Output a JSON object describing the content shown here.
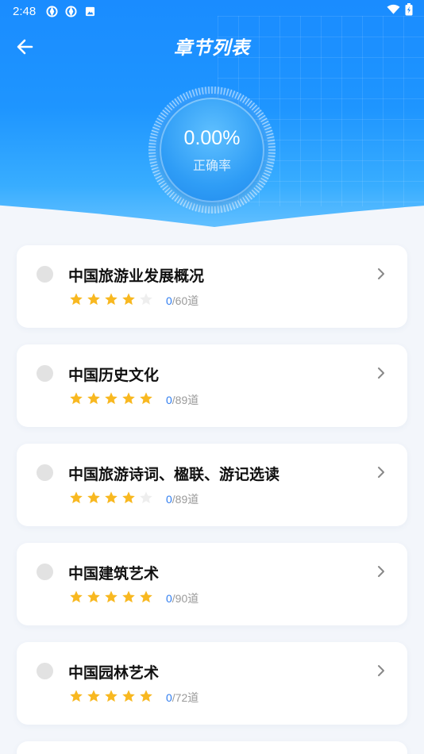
{
  "status_bar": {
    "time": "2:48",
    "icons": [
      "aperture-icon",
      "aperture-icon",
      "image-notification-icon"
    ],
    "right_icons": [
      "wifi-icon",
      "battery-icon"
    ]
  },
  "header": {
    "title": "章节列表",
    "back_icon": "arrow-left-icon"
  },
  "accuracy": {
    "value": "0.00%",
    "label": "正确率"
  },
  "colors": {
    "primary": "#1a8cff",
    "star_on": "#f8b820",
    "star_off": "#eeeeee",
    "done_count": "#2f7df0"
  },
  "chapters": [
    {
      "name": "中国旅游业发展概况",
      "stars": 4,
      "done": "0",
      "total": "/60道"
    },
    {
      "name": "中国历史文化",
      "stars": 5,
      "done": "0",
      "total": "/89道"
    },
    {
      "name": "中国旅游诗词、楹联、游记选读",
      "stars": 4,
      "done": "0",
      "total": "/89道"
    },
    {
      "name": "中国建筑艺术",
      "stars": 5,
      "done": "0",
      "total": "/90道"
    },
    {
      "name": "中国园林艺术",
      "stars": 5,
      "done": "0",
      "total": "/72道"
    }
  ]
}
